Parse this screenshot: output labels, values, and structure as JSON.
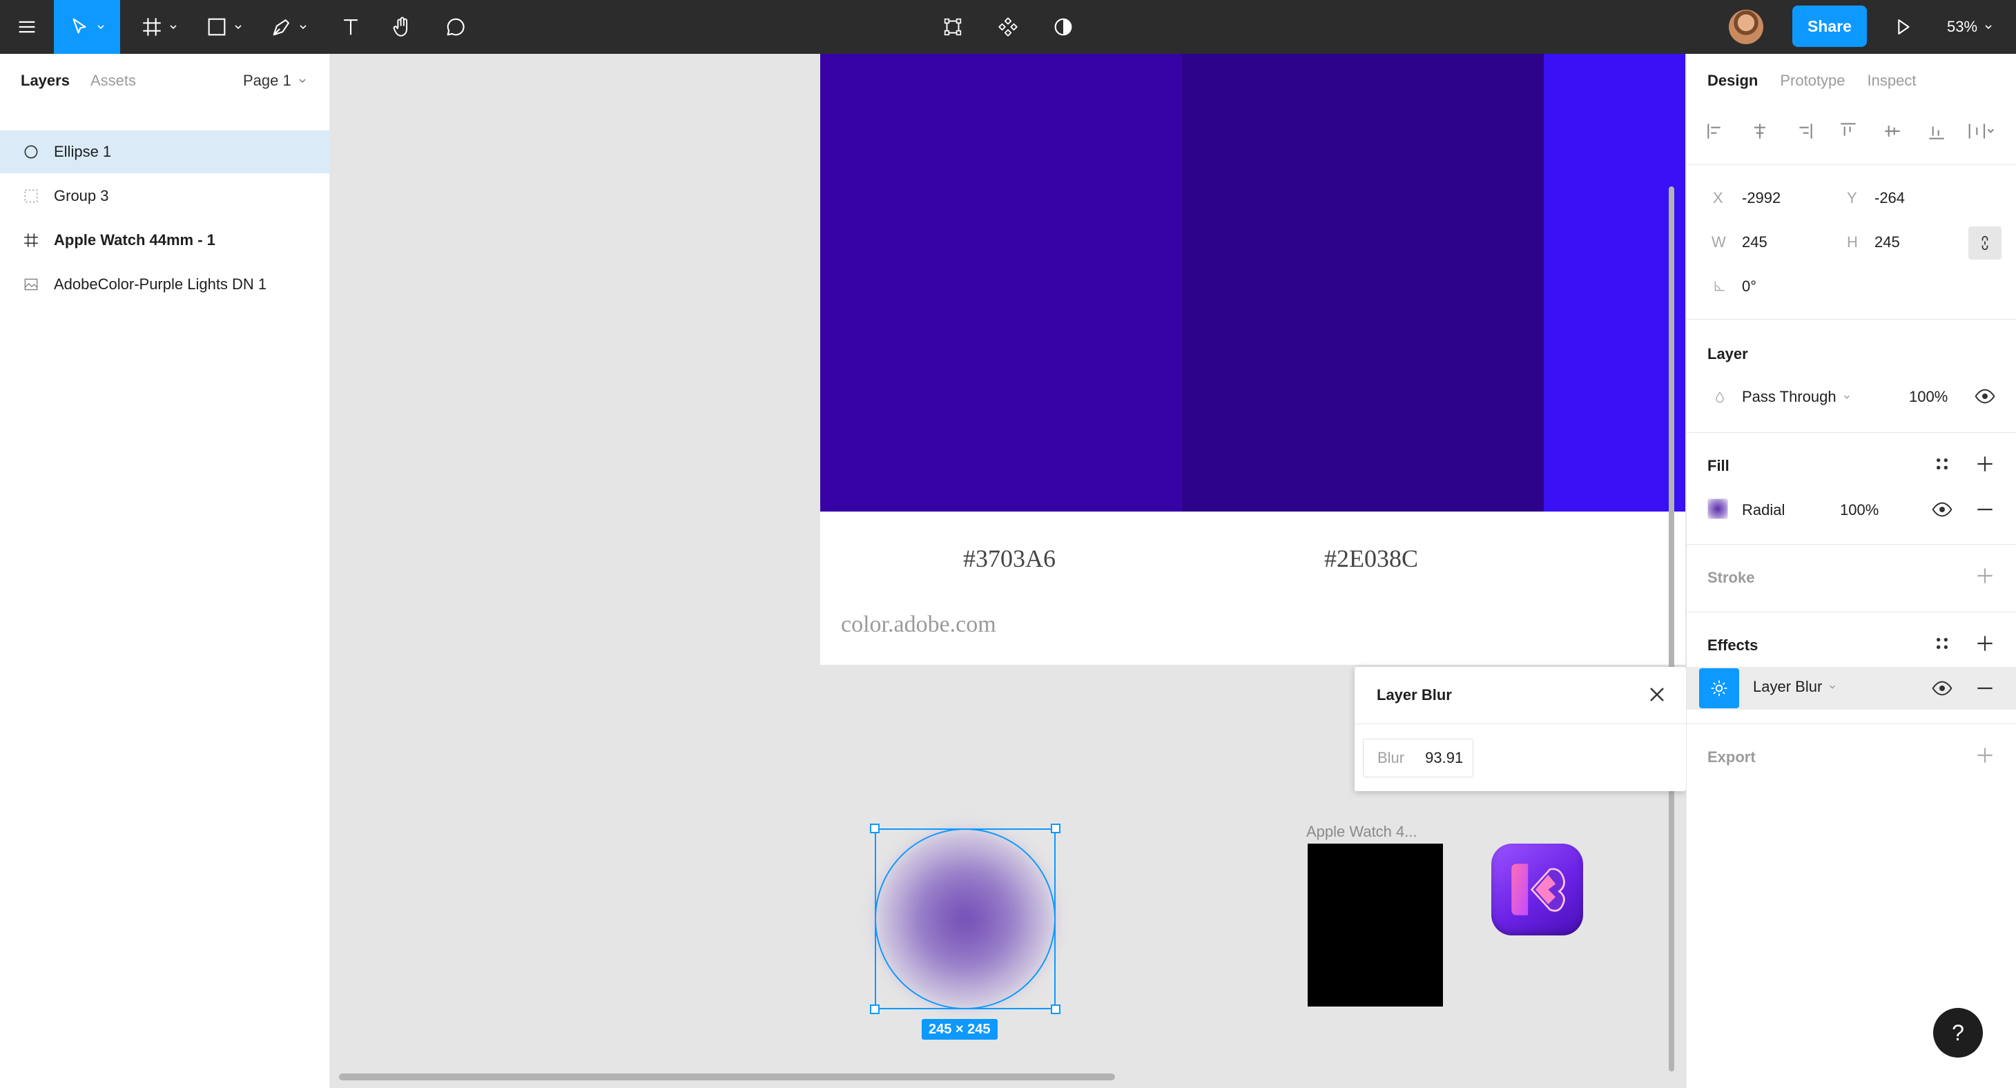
{
  "toolbar": {
    "share_label": "Share",
    "zoom": "53%"
  },
  "left_panel": {
    "tabs": [
      "Layers",
      "Assets"
    ],
    "page": "Page 1",
    "layers": [
      {
        "name": "Ellipse 1",
        "icon": "ellipse-icon",
        "selected": true
      },
      {
        "name": "Group 3",
        "icon": "group-icon",
        "selected": false
      },
      {
        "name": "Apple Watch 44mm - 1",
        "icon": "frame-icon",
        "selected": false
      },
      {
        "name": "AdobeColor-Purple Lights DN 1",
        "icon": "image-icon",
        "selected": false
      }
    ]
  },
  "canvas": {
    "swatches": [
      {
        "color": "#3703A6",
        "label": "#3703A6"
      },
      {
        "color": "#2E038C",
        "label": "#2E038C"
      },
      {
        "color": "#3A10F5",
        "label": ""
      }
    ],
    "palette_source": "color.adobe.com",
    "selection_size": "245 × 245",
    "watch_frame_label": "Apple Watch 4..."
  },
  "blur_popover": {
    "title": "Layer Blur",
    "field_label": "Blur",
    "field_value": "93.91"
  },
  "right_panel": {
    "tabs": [
      "Design",
      "Prototype",
      "Inspect"
    ],
    "x_label": "X",
    "x_value": "-2992",
    "y_label": "Y",
    "y_value": "-264",
    "w_label": "W",
    "w_value": "245",
    "h_label": "H",
    "h_value": "245",
    "rotation": "0°",
    "layer_title": "Layer",
    "blend_mode": "Pass Through",
    "layer_opacity": "100%",
    "fill_title": "Fill",
    "fill_type": "Radial",
    "fill_opacity": "100%",
    "stroke_title": "Stroke",
    "effects_title": "Effects",
    "effect_name": "Layer Blur",
    "export_title": "Export"
  },
  "help_label": "?"
}
